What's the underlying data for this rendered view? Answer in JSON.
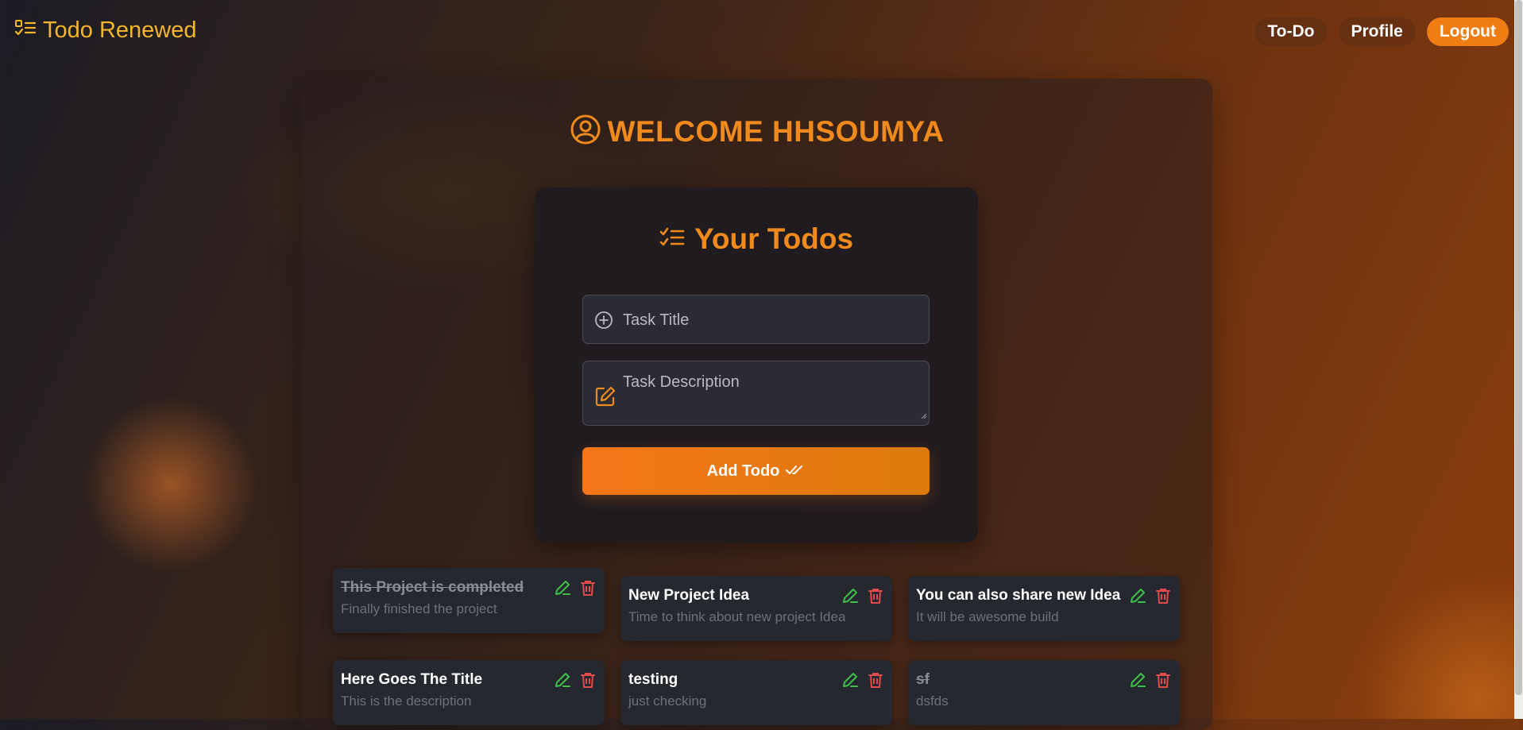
{
  "app": {
    "brand_title": "Todo Renewed",
    "brand_icon": "list-check-icon"
  },
  "nav": {
    "items": [
      {
        "label": "To-Do"
      },
      {
        "label": "Profile"
      },
      {
        "label": "Logout"
      }
    ]
  },
  "welcome": {
    "text": "WELCOME HHSOUMYA",
    "icon": "user-circle-icon"
  },
  "todos_panel": {
    "heading": "Your Todos",
    "heading_icon": "list-check-icon",
    "title_placeholder": "Task Title",
    "description_placeholder": "Task Description",
    "add_button_label": "Add Todo"
  },
  "todo_items": [
    {
      "title": "This Project is completed",
      "description": "Finally finished the project",
      "completed": true
    },
    {
      "title": "New Project Idea",
      "description": "Time to think about new project Idea",
      "completed": false
    },
    {
      "title": "You can also share new Idea",
      "description": "It will be awesome build",
      "completed": false
    },
    {
      "title": "Here Goes The Title",
      "description": "This is the description",
      "completed": false
    },
    {
      "title": "testing",
      "description": "just checking",
      "completed": false
    },
    {
      "title": "sf",
      "description": "dsfds",
      "completed": true
    }
  ],
  "colors": {
    "accent": "#f08a1c",
    "brand": "#f5b52a",
    "edit": "#3fbf4a",
    "delete": "#e24b4b"
  }
}
